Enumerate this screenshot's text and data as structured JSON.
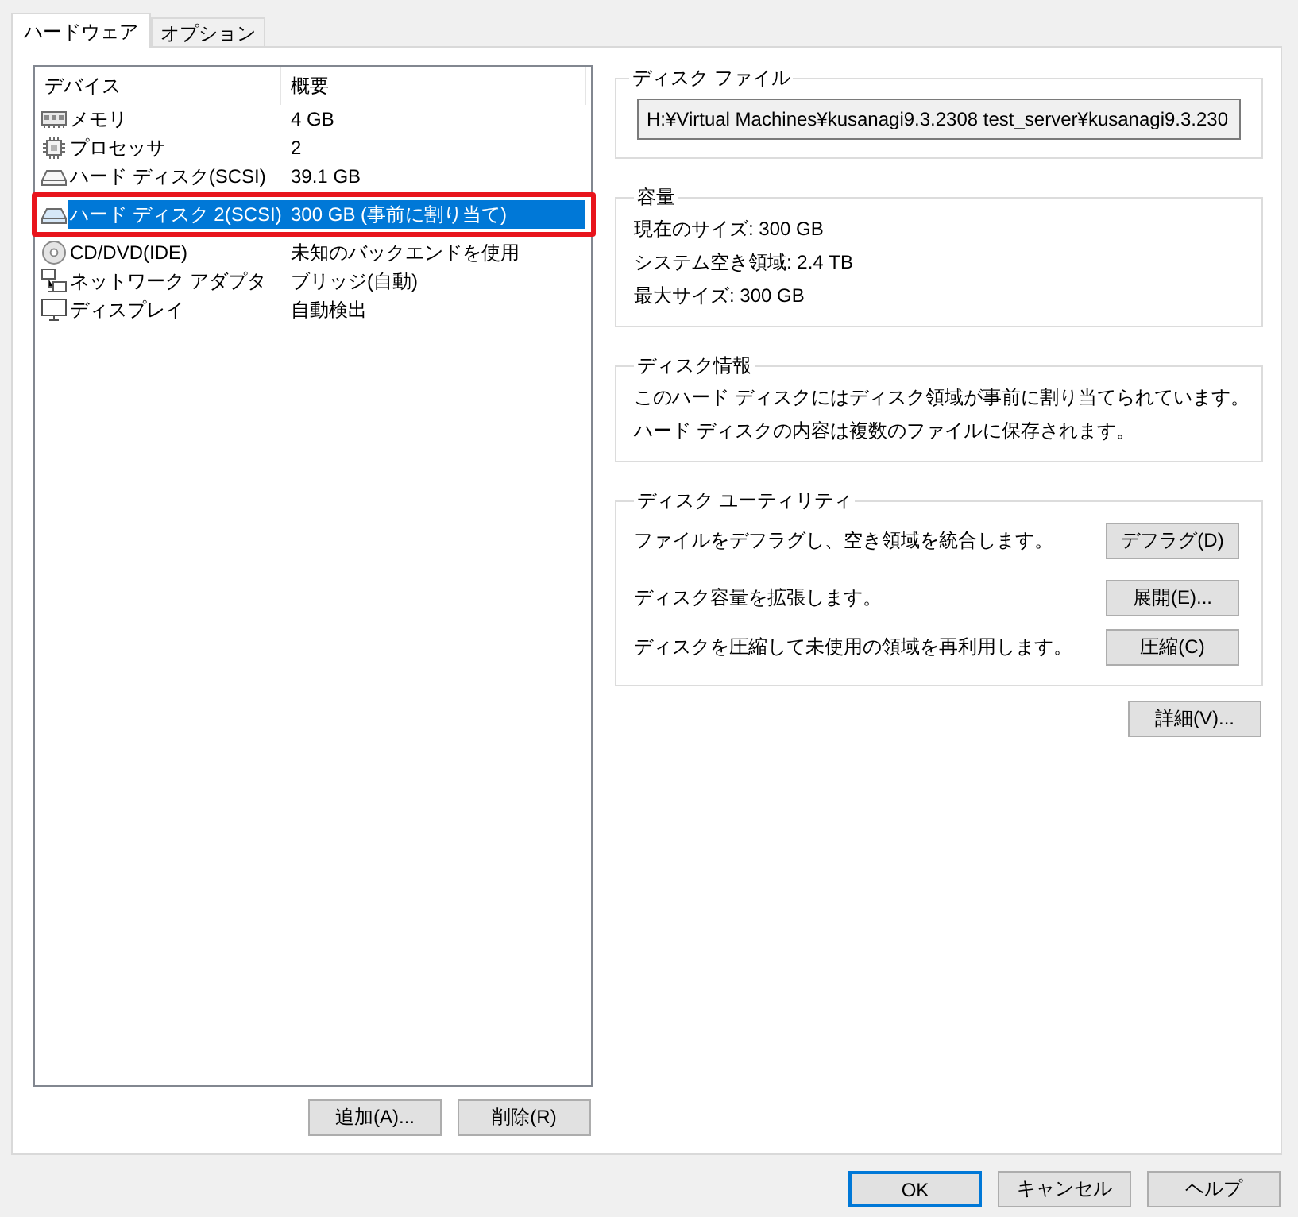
{
  "tabs": [
    {
      "label": "ハードウェア",
      "selected": true
    },
    {
      "label": "オプション",
      "selected": false
    }
  ],
  "device_list": {
    "columns": [
      "デバイス",
      "概要"
    ],
    "rows": [
      {
        "kind": "memory",
        "device": "メモリ",
        "summary": "4 GB",
        "selected": false,
        "annotated": false
      },
      {
        "kind": "processor",
        "device": "プロセッサ",
        "summary": "2",
        "selected": false,
        "annotated": false
      },
      {
        "kind": "disk",
        "device": "ハード ディスク(SCSI)",
        "summary": "39.1 GB",
        "selected": false,
        "annotated": false
      },
      {
        "kind": "disk",
        "device": "ハード ディスク 2(SCSI)",
        "summary": "300 GB (事前に割り当て)",
        "selected": true,
        "annotated": true
      },
      {
        "kind": "cdrom",
        "device": "CD/DVD(IDE)",
        "summary": "未知のバックエンドを使用",
        "selected": false,
        "annotated": false
      },
      {
        "kind": "network",
        "device": "ネットワーク アダプタ",
        "summary": "ブリッジ(自動)",
        "selected": false,
        "annotated": false
      },
      {
        "kind": "display",
        "device": "ディスプレイ",
        "summary": "自動検出",
        "selected": false,
        "annotated": false
      }
    ]
  },
  "list_buttons": [
    "追加(A)...",
    "削除(R)"
  ],
  "disk_file": {
    "title": "ディスク ファイル",
    "path": "H:¥Virtual Machines¥kusanagi9.3.2308 test_server¥kusanagi9.3.230"
  },
  "capacity": {
    "title": "容量",
    "lines": [
      "現在のサイズ: 300 GB",
      "システム空き領域: 2.4 TB",
      "最大サイズ: 300 GB"
    ]
  },
  "disk_info": {
    "title": "ディスク情報",
    "lines": [
      "このハード ディスクにはディスク領域が事前に割り当てられています。",
      "ハード ディスクの内容は複数のファイルに保存されます。"
    ]
  },
  "disk_utilities": {
    "title": "ディスク ユーティリティ",
    "actions": [
      {
        "description": "ファイルをデフラグし、空き領域を統合します。",
        "button": "デフラグ(D)"
      },
      {
        "description": "ディスク容量を拡張します。",
        "button": "展開(E)..."
      },
      {
        "description": "ディスクを圧縮して未使用の領域を再利用します。",
        "button": "圧縮(C)"
      }
    ]
  },
  "advanced_button": "詳細(V)...",
  "dialog_buttons": [
    {
      "label": "OK",
      "default": true
    },
    {
      "label": "キャンセル",
      "default": false
    },
    {
      "label": "ヘルプ",
      "default": false
    }
  ]
}
